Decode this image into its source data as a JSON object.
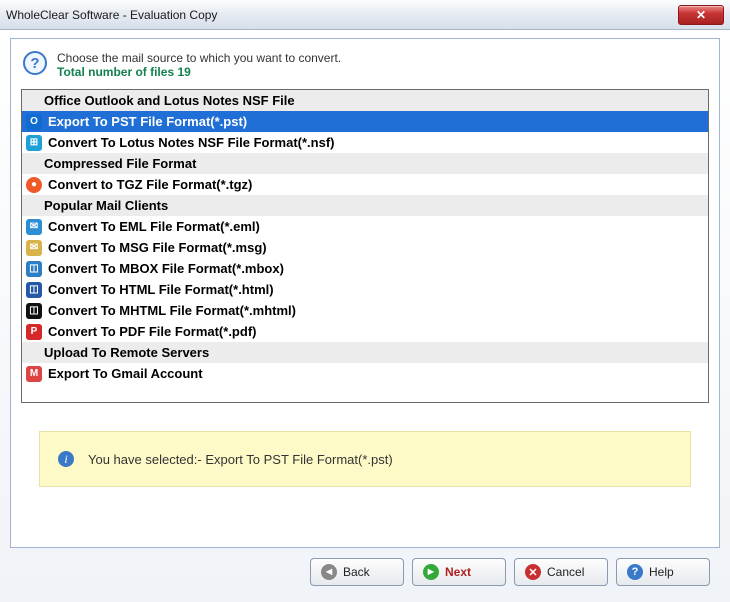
{
  "window": {
    "title": "WholeClear Software - Evaluation Copy"
  },
  "header": {
    "instruction": "Choose the mail source to which you want to convert.",
    "file_count_text": "Total number of files 19"
  },
  "list": {
    "groups": [
      {
        "label": "Office Outlook and Lotus Notes NSF File"
      },
      {
        "label": "Compressed File Format"
      },
      {
        "label": "Popular Mail Clients"
      },
      {
        "label": "Upload To Remote Servers"
      }
    ],
    "items": {
      "pst": {
        "label": "Export To PST File Format(*.pst)"
      },
      "nsf": {
        "label": "Convert To Lotus Notes NSF File Format(*.nsf)"
      },
      "tgz": {
        "label": "Convert to TGZ File Format(*.tgz)"
      },
      "eml": {
        "label": "Convert To EML File Format(*.eml)"
      },
      "msg": {
        "label": "Convert To MSG File Format(*.msg)"
      },
      "mbox": {
        "label": "Convert To MBOX File Format(*.mbox)"
      },
      "html": {
        "label": "Convert To HTML File Format(*.html)"
      },
      "mhtml": {
        "label": "Convert To MHTML File Format(*.mhtml)"
      },
      "pdf": {
        "label": "Convert To PDF File Format(*.pdf)"
      },
      "gmail": {
        "label": "Export To Gmail Account"
      }
    }
  },
  "info": {
    "text": "You have selected:- Export To PST File Format(*.pst)"
  },
  "buttons": {
    "back": "Back",
    "next": "Next",
    "cancel": "Cancel",
    "help": "Help"
  }
}
